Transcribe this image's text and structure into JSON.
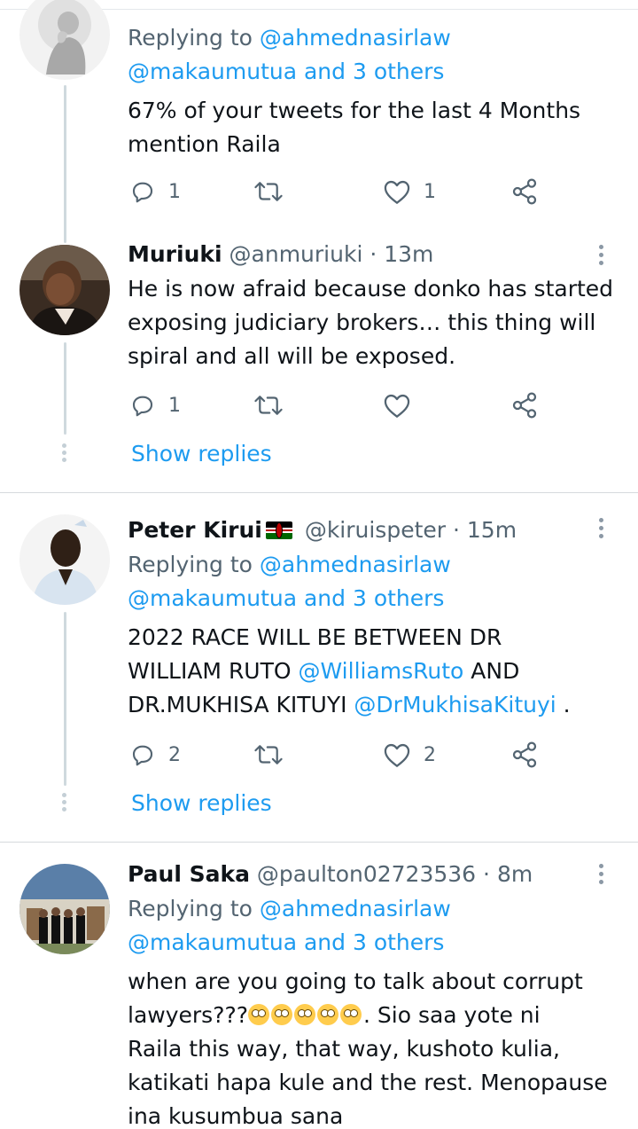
{
  "tweets": [
    {
      "replying_prefix": "Replying to ",
      "replying_handle": "@ahmednasirlaw",
      "replying_rest": "@makaumutua and 3 others",
      "text_lines": [
        "67% of your tweets for the last 4 Months",
        "mention Raila"
      ],
      "actions": {
        "reply_count": "1",
        "retweet_count": "",
        "like_count": "1"
      }
    },
    {
      "name": "Muriuki",
      "handle": "@anmuriuki",
      "time": "13m",
      "text_lines": [
        "He is now afraid because donko has started",
        "exposing judiciary brokers… this thing will",
        "spiral and all will be exposed."
      ],
      "actions": {
        "reply_count": "1",
        "retweet_count": "",
        "like_count": ""
      },
      "show_replies": "Show replies"
    },
    {
      "name": "Peter Kirui",
      "flag": "kenya-flag",
      "handle": "@kiruispeter",
      "time": "15m",
      "replying_prefix": "Replying to ",
      "replying_handle": "@ahmednasirlaw",
      "replying_rest": "@makaumutua and 3 others",
      "text_lines": [
        "2022 RACE WILL BE BETWEEN DR",
        "WILLIAM RUTO ",
        "DR.MUKHISA KITUYI "
      ],
      "mention_1": "@WilliamsRuto",
      "text_after_mention_1": " AND",
      "mention_2": "@DrMukhisaKituyi",
      "text_after_mention_2": " .",
      "actions": {
        "reply_count": "2",
        "retweet_count": "",
        "like_count": "2"
      },
      "show_replies": "Show replies"
    },
    {
      "name": "Paul Saka",
      "handle": "@paulton02723536",
      "time": "8m",
      "replying_prefix": "Replying to ",
      "replying_handle": "@ahmednasirlaw",
      "replying_rest": "@makaumutua and 3 others",
      "text_line_1": "when are you going to talk about corrupt",
      "text_line_2_prefix": "lawyers???",
      "text_line_2_suffix": ". Sio saa yote ni",
      "emoji": "face-with-rolling-eyes-icon",
      "emoji_count": 5,
      "text_lines_rest": [
        "Raila this way, that way, kushoto kulia,",
        "katikati hapa kule and the rest. Menopause",
        "ina kusumbua sana"
      ]
    }
  ],
  "separator": " · ",
  "colors": {
    "link": "#1d9bf0",
    "muted": "#536471",
    "text": "#0f1419",
    "divider": "#d6dadd"
  }
}
